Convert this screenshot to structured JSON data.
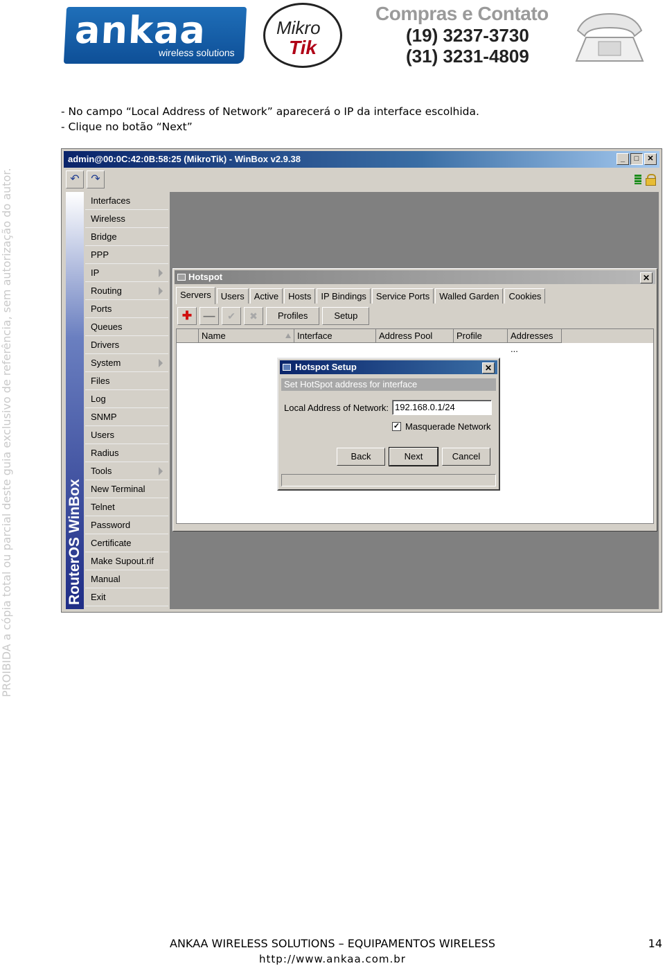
{
  "header": {
    "ankaa_logo": {
      "name": "ankaa",
      "tagline": "wireless solutions"
    },
    "mikrotik_logo": {
      "line1": "Mikro",
      "line2": "Tik"
    },
    "contact": {
      "title": "Compras e Contato",
      "phone1": "(19) 3237-3730",
      "phone2": "(31) 3231-4809"
    }
  },
  "watermark": "PROIBIDA a cópia total ou parcial deste guia exclusivo de referência, sem autorização do autor.",
  "instructions": [
    "- No campo “Local Address of Network” aparecerá o IP da interface escolhida.",
    "- Clique no botão “Next”"
  ],
  "winbox": {
    "title": "admin@00:0C:42:0B:58:25 (MikroTik) - WinBox v2.9.38",
    "brand": "RouterOS WinBox",
    "menu": [
      {
        "label": "Interfaces",
        "submenu": false
      },
      {
        "label": "Wireless",
        "submenu": false
      },
      {
        "label": "Bridge",
        "submenu": false
      },
      {
        "label": "PPP",
        "submenu": false
      },
      {
        "label": "IP",
        "submenu": true
      },
      {
        "label": "Routing",
        "submenu": true
      },
      {
        "label": "Ports",
        "submenu": false
      },
      {
        "label": "Queues",
        "submenu": false
      },
      {
        "label": "Drivers",
        "submenu": false
      },
      {
        "label": "System",
        "submenu": true
      },
      {
        "label": "Files",
        "submenu": false
      },
      {
        "label": "Log",
        "submenu": false
      },
      {
        "label": "SNMP",
        "submenu": false
      },
      {
        "label": "Users",
        "submenu": false
      },
      {
        "label": "Radius",
        "submenu": false
      },
      {
        "label": "Tools",
        "submenu": true
      },
      {
        "label": "New Terminal",
        "submenu": false
      },
      {
        "label": "Telnet",
        "submenu": false
      },
      {
        "label": "Password",
        "submenu": false
      },
      {
        "label": "Certificate",
        "submenu": false
      },
      {
        "label": "Make Supout.rif",
        "submenu": false
      },
      {
        "label": "Manual",
        "submenu": false
      },
      {
        "label": "Exit",
        "submenu": false
      }
    ],
    "hotspot": {
      "title": "Hotspot",
      "tabs": [
        "Servers",
        "Users",
        "Active",
        "Hosts",
        "IP Bindings",
        "Service Ports",
        "Walled Garden",
        "Cookies"
      ],
      "buttons": {
        "profiles": "Profiles",
        "setup": "Setup"
      },
      "columns": [
        "Name",
        "Interface",
        "Address Pool",
        "Profile",
        "Addresses ..."
      ]
    },
    "setup": {
      "title": "Hotspot Setup",
      "subtitle": "Set HotSpot address for interface",
      "label": "Local Address of Network:",
      "value": "192.168.0.1/24",
      "checkbox_label": "Masquerade Network",
      "checked": true,
      "back": "Back",
      "next": "Next",
      "cancel": "Cancel"
    }
  },
  "footer": {
    "company": "ANKAA WIRELESS SOLUTIONS – EQUIPAMENTOS WIRELESS",
    "url": "http://www.ankaa.com.br",
    "page": "14"
  }
}
